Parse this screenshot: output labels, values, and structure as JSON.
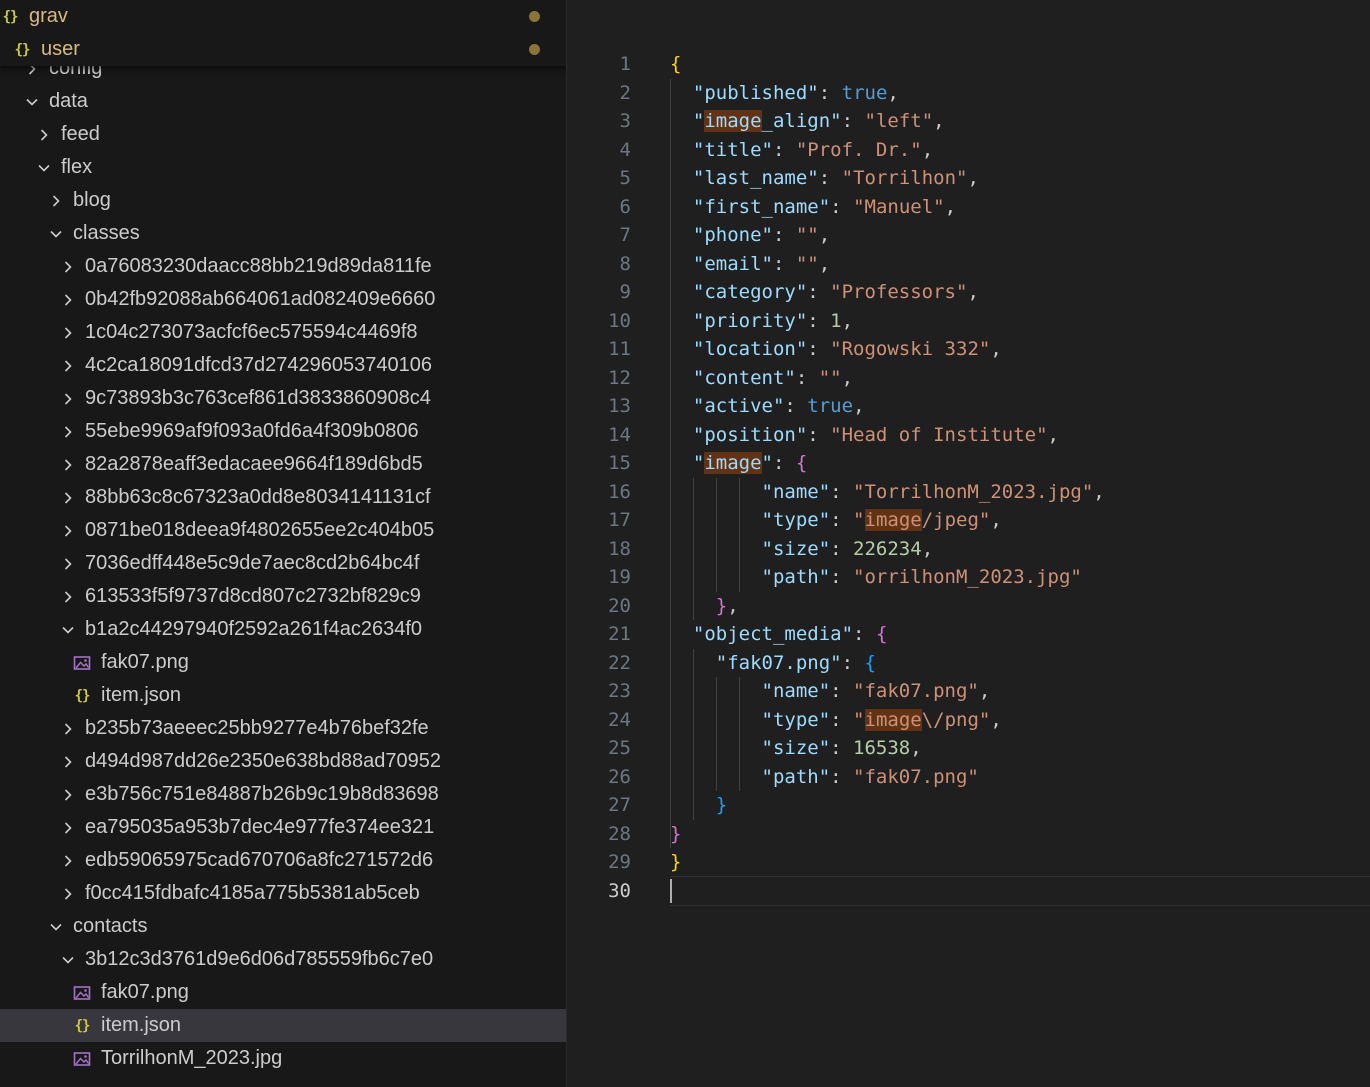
{
  "explorer": {
    "sticky": [
      {
        "label": "grav",
        "depth": 0,
        "expanded": true,
        "modified": true
      },
      {
        "label": "user",
        "depth": 1,
        "expanded": true,
        "modified": true
      }
    ],
    "rows": [
      {
        "label": "config",
        "depth": 2,
        "type": "folder",
        "expanded": false
      },
      {
        "label": "data",
        "depth": 2,
        "type": "folder",
        "expanded": true
      },
      {
        "label": "feed",
        "depth": 3,
        "type": "folder",
        "expanded": false
      },
      {
        "label": "flex",
        "depth": 3,
        "type": "folder",
        "expanded": true
      },
      {
        "label": "blog",
        "depth": 4,
        "type": "folder",
        "expanded": false
      },
      {
        "label": "classes",
        "depth": 4,
        "type": "folder",
        "expanded": true
      },
      {
        "label": "0a76083230daacc88bb219d89da811fe",
        "depth": 5,
        "type": "folder",
        "expanded": false
      },
      {
        "label": "0b42fb92088ab664061ad082409e6660",
        "depth": 5,
        "type": "folder",
        "expanded": false
      },
      {
        "label": "1c04c273073acfcf6ec575594c4469f8",
        "depth": 5,
        "type": "folder",
        "expanded": false
      },
      {
        "label": "4c2ca18091dfcd37d274296053740106",
        "depth": 5,
        "type": "folder",
        "expanded": false
      },
      {
        "label": "9c73893b3c763cef861d3833860908c4",
        "depth": 5,
        "type": "folder",
        "expanded": false
      },
      {
        "label": "55ebe9969af9f093a0fd6a4f309b0806",
        "depth": 5,
        "type": "folder",
        "expanded": false
      },
      {
        "label": "82a2878eaff3edacaee9664f189d6bd5",
        "depth": 5,
        "type": "folder",
        "expanded": false
      },
      {
        "label": "88bb63c8c67323a0dd8e8034141131cf",
        "depth": 5,
        "type": "folder",
        "expanded": false
      },
      {
        "label": "0871be018deea9f4802655ee2c404b05",
        "depth": 5,
        "type": "folder",
        "expanded": false
      },
      {
        "label": "7036edff448e5c9de7aec8cd2b64bc4f",
        "depth": 5,
        "type": "folder",
        "expanded": false
      },
      {
        "label": "613533f5f9737d8cd807c2732bf829c9",
        "depth": 5,
        "type": "folder",
        "expanded": false
      },
      {
        "label": "b1a2c44297940f2592a261f4ac2634f0",
        "depth": 5,
        "type": "folder",
        "expanded": true
      },
      {
        "label": "fak07.png",
        "depth": 6,
        "type": "image"
      },
      {
        "label": "item.json",
        "depth": 6,
        "type": "json"
      },
      {
        "label": "b235b73aeeec25bb9277e4b76bef32fe",
        "depth": 5,
        "type": "folder",
        "expanded": false
      },
      {
        "label": "d494d987dd26e2350e638bd88ad70952",
        "depth": 5,
        "type": "folder",
        "expanded": false
      },
      {
        "label": "e3b756c751e84887b26b9c19b8d83698",
        "depth": 5,
        "type": "folder",
        "expanded": false
      },
      {
        "label": "ea795035a953b7dec4e977fe374ee321",
        "depth": 5,
        "type": "folder",
        "expanded": false
      },
      {
        "label": "edb59065975cad670706a8fc271572d6",
        "depth": 5,
        "type": "folder",
        "expanded": false
      },
      {
        "label": "f0cc415fdbafc4185a775b5381ab5ceb",
        "depth": 5,
        "type": "folder",
        "expanded": false
      },
      {
        "label": "contacts",
        "depth": 4,
        "type": "folder",
        "expanded": true
      },
      {
        "label": "3b12c3d3761d9e6d06d785559fb6c7e0",
        "depth": 5,
        "type": "folder",
        "expanded": true
      },
      {
        "label": "fak07.png",
        "depth": 6,
        "type": "image"
      },
      {
        "label": "item.json",
        "depth": 6,
        "type": "json",
        "selected": true
      },
      {
        "label": "TorrilhonM_2023.jpg",
        "depth": 6,
        "type": "image"
      }
    ]
  },
  "editor": {
    "current_line": 30,
    "lines": [
      {
        "n": "1",
        "indent": 0,
        "t": [
          [
            "br1",
            "{"
          ]
        ]
      },
      {
        "n": "2",
        "indent": 1,
        "t": [
          [
            "k",
            "\"published\""
          ],
          [
            "p",
            ": "
          ],
          [
            "b",
            "true"
          ],
          [
            "p",
            ","
          ]
        ]
      },
      {
        "n": "3",
        "indent": 1,
        "t": [
          [
            "k",
            "\""
          ],
          [
            "khl",
            "image"
          ],
          [
            "k",
            "_align\""
          ],
          [
            "p",
            ": "
          ],
          [
            "s",
            "\"left\""
          ],
          [
            "p",
            ","
          ]
        ]
      },
      {
        "n": "4",
        "indent": 1,
        "t": [
          [
            "k",
            "\"title\""
          ],
          [
            "p",
            ": "
          ],
          [
            "s",
            "\"Prof. Dr.\""
          ],
          [
            "p",
            ","
          ]
        ]
      },
      {
        "n": "5",
        "indent": 1,
        "t": [
          [
            "k",
            "\"last_name\""
          ],
          [
            "p",
            ": "
          ],
          [
            "s",
            "\"Torrilhon\""
          ],
          [
            "p",
            ","
          ]
        ]
      },
      {
        "n": "6",
        "indent": 1,
        "t": [
          [
            "k",
            "\"first_name\""
          ],
          [
            "p",
            ": "
          ],
          [
            "s",
            "\"Manuel\""
          ],
          [
            "p",
            ","
          ]
        ]
      },
      {
        "n": "7",
        "indent": 1,
        "t": [
          [
            "k",
            "\"phone\""
          ],
          [
            "p",
            ": "
          ],
          [
            "s",
            "\"\""
          ],
          [
            "p",
            ","
          ]
        ]
      },
      {
        "n": "8",
        "indent": 1,
        "t": [
          [
            "k",
            "\"email\""
          ],
          [
            "p",
            ": "
          ],
          [
            "s",
            "\"\""
          ],
          [
            "p",
            ","
          ]
        ]
      },
      {
        "n": "9",
        "indent": 1,
        "t": [
          [
            "k",
            "\"category\""
          ],
          [
            "p",
            ": "
          ],
          [
            "s",
            "\"Professors\""
          ],
          [
            "p",
            ","
          ]
        ]
      },
      {
        "n": "10",
        "indent": 1,
        "t": [
          [
            "k",
            "\"priority\""
          ],
          [
            "p",
            ": "
          ],
          [
            "n",
            "1"
          ],
          [
            "p",
            ","
          ]
        ]
      },
      {
        "n": "11",
        "indent": 1,
        "t": [
          [
            "k",
            "\"location\""
          ],
          [
            "p",
            ": "
          ],
          [
            "s",
            "\"Rogowski 332\""
          ],
          [
            "p",
            ","
          ]
        ]
      },
      {
        "n": "12",
        "indent": 1,
        "t": [
          [
            "k",
            "\"content\""
          ],
          [
            "p",
            ": "
          ],
          [
            "s",
            "\"\""
          ],
          [
            "p",
            ","
          ]
        ]
      },
      {
        "n": "13",
        "indent": 1,
        "t": [
          [
            "k",
            "\"active\""
          ],
          [
            "p",
            ": "
          ],
          [
            "b",
            "true"
          ],
          [
            "p",
            ","
          ]
        ]
      },
      {
        "n": "14",
        "indent": 1,
        "t": [
          [
            "k",
            "\"position\""
          ],
          [
            "p",
            ": "
          ],
          [
            "s",
            "\"Head of Institute\""
          ],
          [
            "p",
            ","
          ]
        ]
      },
      {
        "n": "15",
        "indent": 1,
        "t": [
          [
            "k",
            "\""
          ],
          [
            "khl",
            "image"
          ],
          [
            "k",
            "\""
          ],
          [
            "p",
            ": "
          ],
          [
            "br2",
            "{"
          ]
        ]
      },
      {
        "n": "16",
        "indent": 4,
        "t": [
          [
            "k",
            "\"name\""
          ],
          [
            "p",
            ": "
          ],
          [
            "s",
            "\"TorrilhonM_2023.jpg\""
          ],
          [
            "p",
            ","
          ]
        ]
      },
      {
        "n": "17",
        "indent": 4,
        "t": [
          [
            "k",
            "\"type\""
          ],
          [
            "p",
            ": "
          ],
          [
            "s",
            "\""
          ],
          [
            "shl",
            "image"
          ],
          [
            "s",
            "/jpeg\""
          ],
          [
            "p",
            ","
          ]
        ]
      },
      {
        "n": "18",
        "indent": 4,
        "t": [
          [
            "k",
            "\"size\""
          ],
          [
            "p",
            ": "
          ],
          [
            "n",
            "226234"
          ],
          [
            "p",
            ","
          ]
        ]
      },
      {
        "n": "19",
        "indent": 4,
        "t": [
          [
            "k",
            "\"path\""
          ],
          [
            "p",
            ": "
          ],
          [
            "s",
            "\"orrilhonM_2023.jpg\""
          ]
        ]
      },
      {
        "n": "20",
        "indent": 2,
        "t": [
          [
            "br2",
            "}"
          ],
          [
            "p",
            ","
          ]
        ]
      },
      {
        "n": "21",
        "indent": 1,
        "t": [
          [
            "k",
            "\"object_media\""
          ],
          [
            "p",
            ": "
          ],
          [
            "br2",
            "{"
          ]
        ]
      },
      {
        "n": "22",
        "indent": 2,
        "t": [
          [
            "k",
            "\"fak07.png\""
          ],
          [
            "p",
            ": "
          ],
          [
            "br3",
            "{"
          ]
        ]
      },
      {
        "n": "23",
        "indent": 4,
        "t": [
          [
            "k",
            "\"name\""
          ],
          [
            "p",
            ": "
          ],
          [
            "s",
            "\"fak07.png\""
          ],
          [
            "p",
            ","
          ]
        ]
      },
      {
        "n": "24",
        "indent": 4,
        "t": [
          [
            "k",
            "\"type\""
          ],
          [
            "p",
            ": "
          ],
          [
            "s",
            "\""
          ],
          [
            "shl",
            "image"
          ],
          [
            "s",
            "\\/png\""
          ],
          [
            "p",
            ","
          ]
        ]
      },
      {
        "n": "25",
        "indent": 4,
        "t": [
          [
            "k",
            "\"size\""
          ],
          [
            "p",
            ": "
          ],
          [
            "n",
            "16538"
          ],
          [
            "p",
            ","
          ]
        ]
      },
      {
        "n": "26",
        "indent": 4,
        "t": [
          [
            "k",
            "\"path\""
          ],
          [
            "p",
            ": "
          ],
          [
            "s",
            "\"fak07.png\""
          ]
        ]
      },
      {
        "n": "27",
        "indent": 2,
        "t": [
          [
            "br3",
            "}"
          ]
        ]
      },
      {
        "n": "28",
        "indent": 0,
        "t": [
          [
            "br2",
            "}"
          ]
        ]
      },
      {
        "n": "29",
        "indent": 0,
        "t": [
          [
            "br1",
            "}"
          ]
        ]
      },
      {
        "n": "30",
        "indent": 0,
        "t": []
      }
    ]
  }
}
